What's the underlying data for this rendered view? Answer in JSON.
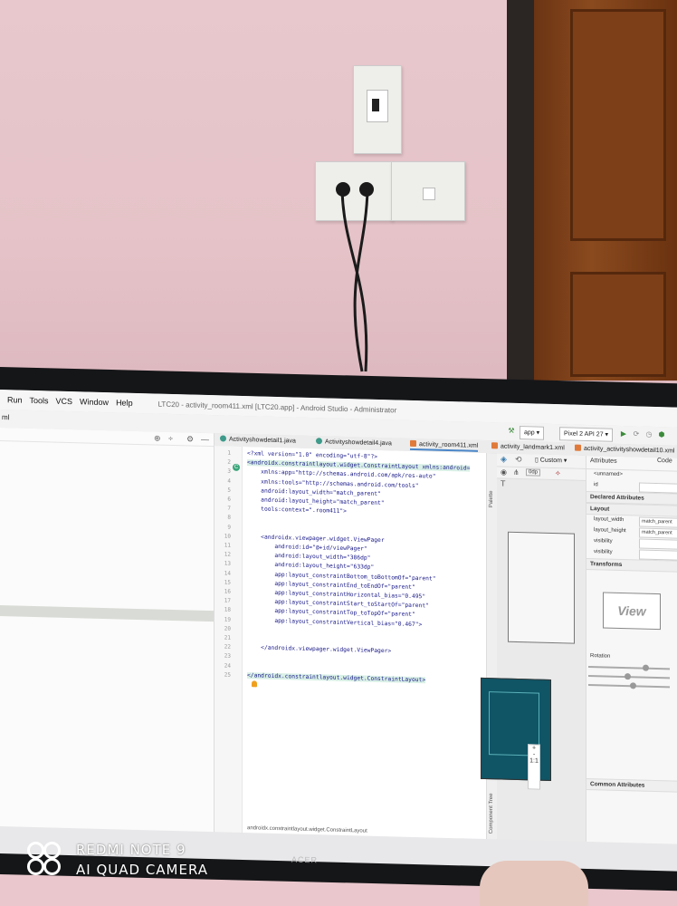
{
  "menubar": {
    "items": [
      "Run",
      "Tools",
      "VCS",
      "Window",
      "Help"
    ],
    "title": "LTC20 - activity_room411.xml [LTC20.app] - Android Studio - Administrator"
  },
  "toolbar": {
    "left_label": "ml",
    "run_config": "app",
    "device": "Pixel 2 API 27"
  },
  "tabs": [
    {
      "label": "Activityshowdetail1.java",
      "type": "java",
      "active": false
    },
    {
      "label": "Activityshowdetail4.java",
      "type": "java",
      "active": false
    },
    {
      "label": "activity_room411.xml",
      "type": "xml",
      "active": true
    },
    {
      "label": "activity_landmark1.xml",
      "type": "xml",
      "active": false
    },
    {
      "label": "activity_activityshowdetail10.xml",
      "type": "xml",
      "active": false
    }
  ],
  "code_view_label": "Code",
  "editor": {
    "lines": [
      {
        "n": "1",
        "text": "<?xml version=\"1.0\" encoding=\"utf-8\"?>"
      },
      {
        "n": "2",
        "text": "<androidx.constraintlayout.widget.ConstraintLayout xmlns:android=",
        "hl": true
      },
      {
        "n": "3",
        "text": "    xmlns:app=\"http://schemas.android.com/apk/res-auto\""
      },
      {
        "n": "4",
        "text": "    xmlns:tools=\"http://schemas.android.com/tools\""
      },
      {
        "n": "5",
        "text": "    android:layout_width=\"match_parent\""
      },
      {
        "n": "6",
        "text": "    android:layout_height=\"match_parent\""
      },
      {
        "n": "7",
        "text": "    tools:context=\".room411\">"
      },
      {
        "n": "8",
        "text": ""
      },
      {
        "n": "9",
        "text": ""
      },
      {
        "n": "10",
        "text": "    <androidx.viewpager.widget.ViewPager"
      },
      {
        "n": "11",
        "text": "        android:id=\"@+id/viewPager\""
      },
      {
        "n": "12",
        "text": "        android:layout_width=\"386dp\""
      },
      {
        "n": "13",
        "text": "        android:layout_height=\"633dp\""
      },
      {
        "n": "14",
        "text": "        app:layout_constraintBottom_toBottomOf=\"parent\""
      },
      {
        "n": "15",
        "text": "        app:layout_constraintEnd_toEndOf=\"parent\""
      },
      {
        "n": "16",
        "text": "        app:layout_constraintHorizontal_bias=\"0.495\""
      },
      {
        "n": "17",
        "text": "        app:layout_constraintStart_toStartOf=\"parent\""
      },
      {
        "n": "18",
        "text": "        app:layout_constraintTop_toTopOf=\"parent\""
      },
      {
        "n": "19",
        "text": "        app:layout_constraintVertical_bias=\"0.467\">"
      },
      {
        "n": "20",
        "text": ""
      },
      {
        "n": "21",
        "text": ""
      },
      {
        "n": "22",
        "text": "    </androidx.viewpager.widget.ViewPager>"
      },
      {
        "n": "23",
        "text": ""
      },
      {
        "n": "24",
        "text": ""
      },
      {
        "n": "25",
        "text": "</androidx.constraintlayout.widget.ConstraintLayout>",
        "hl": true
      }
    ],
    "breadcrumb": "androidx.constraintlayout.widget.ConstraintLayout"
  },
  "palette_label": "Palette",
  "component_tree_label": "Component Tree",
  "design": {
    "device_button": "Custom",
    "zoom_in": "+",
    "zoom_out": "-",
    "zoom_ratio": "1:1"
  },
  "attributes": {
    "title": "Attributes",
    "component": "<unnamed>",
    "id_label": "id",
    "declared_section": "Declared Attributes",
    "layout_section": "Layout",
    "rows": [
      {
        "key": "layout_width",
        "value": "match_parent"
      },
      {
        "key": "layout_height",
        "value": "match_parent"
      },
      {
        "key": "visibility",
        "value": ""
      },
      {
        "key": "visibility",
        "value": ""
      }
    ],
    "transforms_section": "Transforms",
    "view_label": "View",
    "rotation_label": "Rotation",
    "common_section": "Common Attributes"
  },
  "watermark": {
    "line1": "REDMI NOTE 9",
    "line2": "AI QUAD CAMERA"
  },
  "monitor_brand": "ACER"
}
